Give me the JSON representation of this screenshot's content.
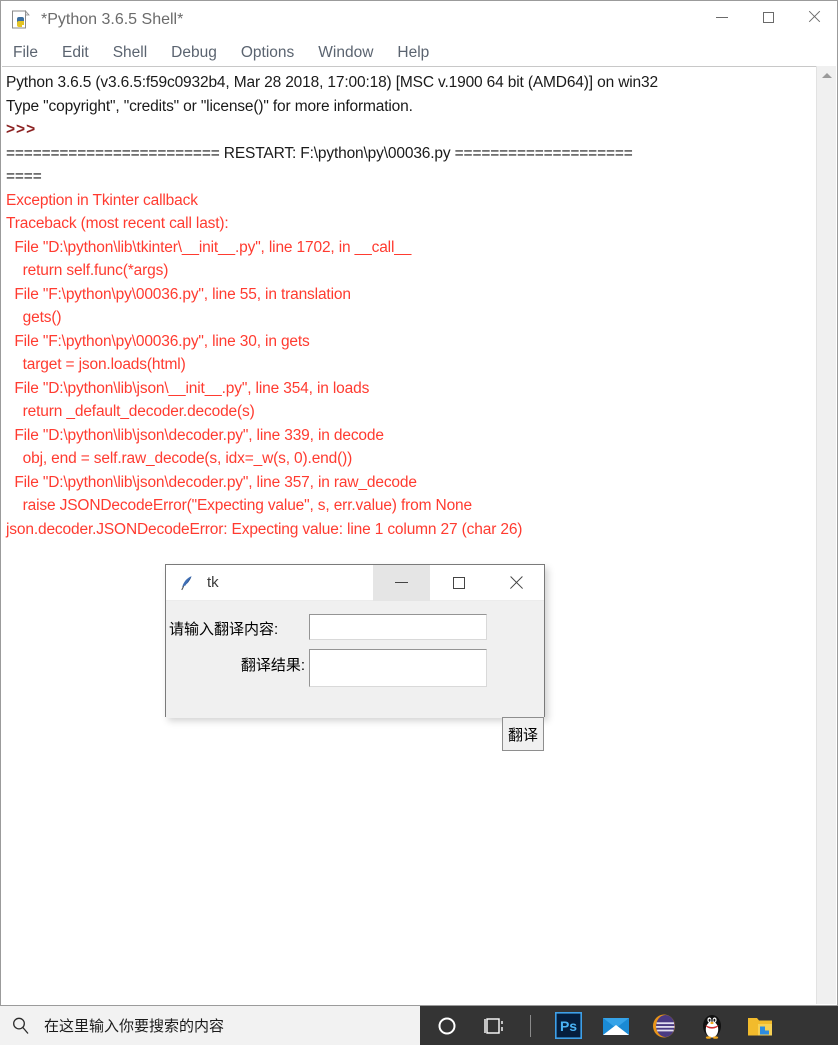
{
  "idle_window": {
    "title": "*Python 3.6.5 Shell*",
    "app_icon": "python-idle-icon",
    "controls": {
      "minimize": "minimize-icon",
      "maximize": "maximize-icon",
      "close": "close-icon"
    },
    "menu": [
      {
        "label": "File"
      },
      {
        "label": "Edit"
      },
      {
        "label": "Shell"
      },
      {
        "label": "Debug"
      },
      {
        "label": "Options"
      },
      {
        "label": "Window"
      },
      {
        "label": "Help"
      }
    ],
    "console_lines": [
      {
        "text": "Python 3.6.5 (v3.6.5:f59c0932b4, Mar 28 2018, 17:00:18) [MSC v.1900 64 bit (AMD64)] on win32",
        "style": "normal"
      },
      {
        "text": "Type \"copyright\", \"credits\" or \"license()\" for more information.",
        "style": "normal"
      },
      {
        "text": ">>> ",
        "style": "prompt"
      },
      {
        "text": "======================== RESTART: F:\\python\\py\\00036.py ====================",
        "style": "normal"
      },
      {
        "text": "====",
        "style": "normal"
      },
      {
        "text": "Exception in Tkinter callback",
        "style": "error"
      },
      {
        "text": "Traceback (most recent call last):",
        "style": "error"
      },
      {
        "text": "  File \"D:\\python\\lib\\tkinter\\__init__.py\", line 1702, in __call__",
        "style": "error"
      },
      {
        "text": "    return self.func(*args)",
        "style": "error"
      },
      {
        "text": "  File \"F:\\python\\py\\00036.py\", line 55, in translation",
        "style": "error"
      },
      {
        "text": "    gets()",
        "style": "error"
      },
      {
        "text": "  File \"F:\\python\\py\\00036.py\", line 30, in gets",
        "style": "error"
      },
      {
        "text": "    target = json.loads(html)",
        "style": "error"
      },
      {
        "text": "  File \"D:\\python\\lib\\json\\__init__.py\", line 354, in loads",
        "style": "error"
      },
      {
        "text": "    return _default_decoder.decode(s)",
        "style": "error"
      },
      {
        "text": "  File \"D:\\python\\lib\\json\\decoder.py\", line 339, in decode",
        "style": "error"
      },
      {
        "text": "    obj, end = self.raw_decode(s, idx=_w(s, 0).end())",
        "style": "error"
      },
      {
        "text": "  File \"D:\\python\\lib\\json\\decoder.py\", line 357, in raw_decode",
        "style": "error"
      },
      {
        "text": "    raise JSONDecodeError(\"Expecting value\", s, err.value) from None",
        "style": "error"
      },
      {
        "text": "json.decoder.JSONDecodeError: Expecting value: line 1 column 27 (char 26)",
        "style": "error"
      }
    ],
    "scrollbar": {
      "up_arrow": "scroll-up-arrow-icon",
      "down_arrow": "scroll-down-arrow-icon"
    }
  },
  "tk_window": {
    "title": "tk",
    "app_icon": "tk-feather-icon",
    "controls": {
      "minimize": "minimize-icon",
      "maximize": "maximize-icon",
      "close": "close-icon"
    },
    "label_input": "请输入翻译内容:",
    "label_result": "翻译结果:",
    "entry_input_value": "",
    "entry_result_value": "",
    "translate_button": "翻译"
  },
  "taskbar": {
    "search_icon": "search-icon",
    "search_placeholder": "在这里输入你要搜索的内容",
    "icons": [
      {
        "name": "cortana-circle-icon"
      },
      {
        "name": "task-view-icon"
      },
      {
        "name": "separator"
      },
      {
        "name": "photoshop-icon",
        "label": "Ps"
      },
      {
        "name": "mail-icon"
      },
      {
        "name": "thunder-oval-icon"
      },
      {
        "name": "qq-penguin-icon"
      },
      {
        "name": "file-explorer-icon"
      }
    ]
  },
  "colors": {
    "error_text": "#ff3b30",
    "prompt_text": "#8b2222",
    "normal_text": "#1a1a1a",
    "taskbar_dark": "#343434",
    "taskbar_light": "#f2f2f2",
    "dialog_bg": "#f0f0f0"
  }
}
